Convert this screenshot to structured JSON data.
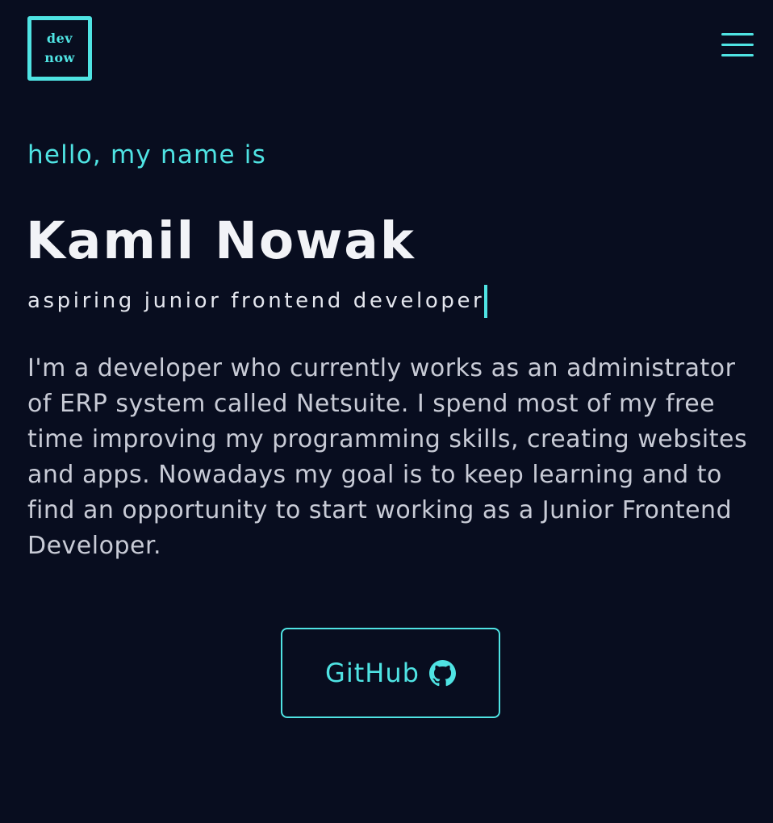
{
  "header": {
    "logo_line1": "dev",
    "logo_line2": "now",
    "menu_icon": "hamburger-menu-icon"
  },
  "hero": {
    "greeting": "hello, my name is",
    "name": "Kamil Nowak",
    "role": "aspiring junior frontend developer",
    "about": "I'm a developer who currently works as an administrator of ERP system called Netsuite. I spend most of my free time improving my programming skills, creating websites and apps. Nowadays my goal is to keep learning and to find an opportunity to start working as a Junior Frontend Developer.",
    "github_label": "GitHub",
    "github_icon": "github-icon"
  },
  "colors": {
    "background": "#080d1f",
    "accent": "#4fe3e3",
    "text": "#f2f3f7",
    "muted_text": "#c8cbd6"
  }
}
